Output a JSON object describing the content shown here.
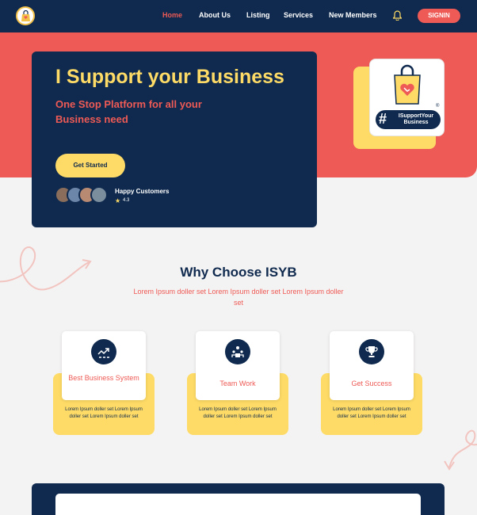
{
  "nav": {
    "links": [
      {
        "label": "Home",
        "active": true
      },
      {
        "label": "About Us",
        "active": false
      },
      {
        "label": "Listing",
        "active": false
      },
      {
        "label": "Services",
        "active": false
      },
      {
        "label": "New Members",
        "active": false
      }
    ],
    "signin_label": "SIGNIN",
    "icons": {
      "logo": "shopping-bag-logo-icon",
      "notification": "bell-icon"
    }
  },
  "hero": {
    "title": "I Support your Business",
    "subtitle": "One Stop Platform for all your Business need",
    "cta_label": "Get Started",
    "customers_label": "Happy Customers",
    "rating": "4.3",
    "badge_hash": "#",
    "badge_text": "ISupportYour Business",
    "badge_reg": "®"
  },
  "why": {
    "title": "Why Choose ISYB",
    "subtitle": "Lorem Ipsum doller set Lorem Ipsum doller set Lorem Ipsum doller set"
  },
  "features": [
    {
      "title": "Best Business System",
      "description": "Lorem Ipsum doller set Lorem Ipsum doller set Lorem Ipsum doller set",
      "icon": "growth-chart-icon"
    },
    {
      "title": "Team Work",
      "description": "Lorem Ipsum doller set Lorem Ipsum doller set Lorem Ipsum doller set",
      "icon": "team-icon"
    },
    {
      "title": "Get Success",
      "description": "Lorem Ipsum doller set Lorem Ipsum doller set Lorem Ipsum doller set",
      "icon": "trophy-icon"
    }
  ],
  "colors": {
    "navy": "#0f2a4e",
    "coral": "#ee5a55",
    "yellow": "#fedb66",
    "background": "#f4f3f3"
  }
}
